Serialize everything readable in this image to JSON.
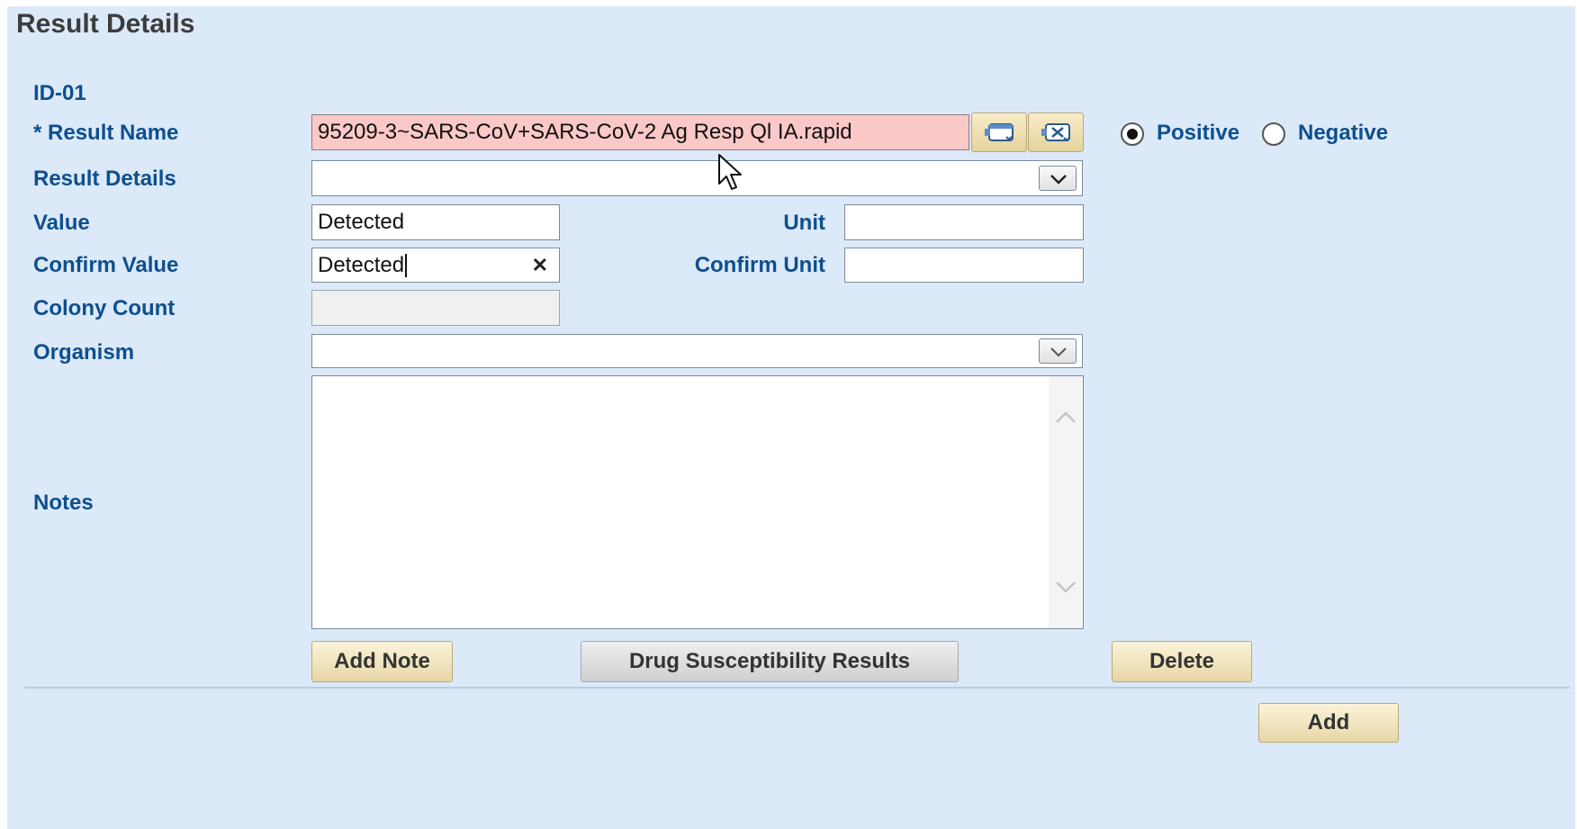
{
  "section_title": "Result Details",
  "record_id": "ID-01",
  "labels": {
    "result_name": "* Result Name",
    "result_details": "Result Details",
    "value": "Value",
    "unit": "Unit",
    "confirm_value": "Confirm Value",
    "confirm_unit": "Confirm Unit",
    "colony_count": "Colony Count",
    "organism": "Organism",
    "notes": "Notes"
  },
  "fields": {
    "result_name": "95209-3~SARS-CoV+SARS-CoV-2 Ag Resp Ql IA.rapid",
    "result_details": "",
    "value": "Detected",
    "unit": "",
    "confirm_value": "Detected",
    "confirm_unit": "",
    "colony_count": "",
    "organism": "",
    "notes": ""
  },
  "radio": {
    "positive_label": "Positive",
    "negative_label": "Negative",
    "selected": "Positive"
  },
  "buttons": {
    "add_note": "Add Note",
    "drug_susceptibility": "Drug Susceptibility Results",
    "delete": "Delete",
    "add": "Add"
  },
  "colors": {
    "panel_bg": "#dbe9f9",
    "label_color": "#0e4f8e",
    "required_highlight": "#fbc8c8"
  },
  "icons": [
    "lookup-icon",
    "clear-lookup-icon",
    "chevron-down-icon",
    "clear-x-icon",
    "chevron-up-icon",
    "mouse-pointer-icon"
  ]
}
